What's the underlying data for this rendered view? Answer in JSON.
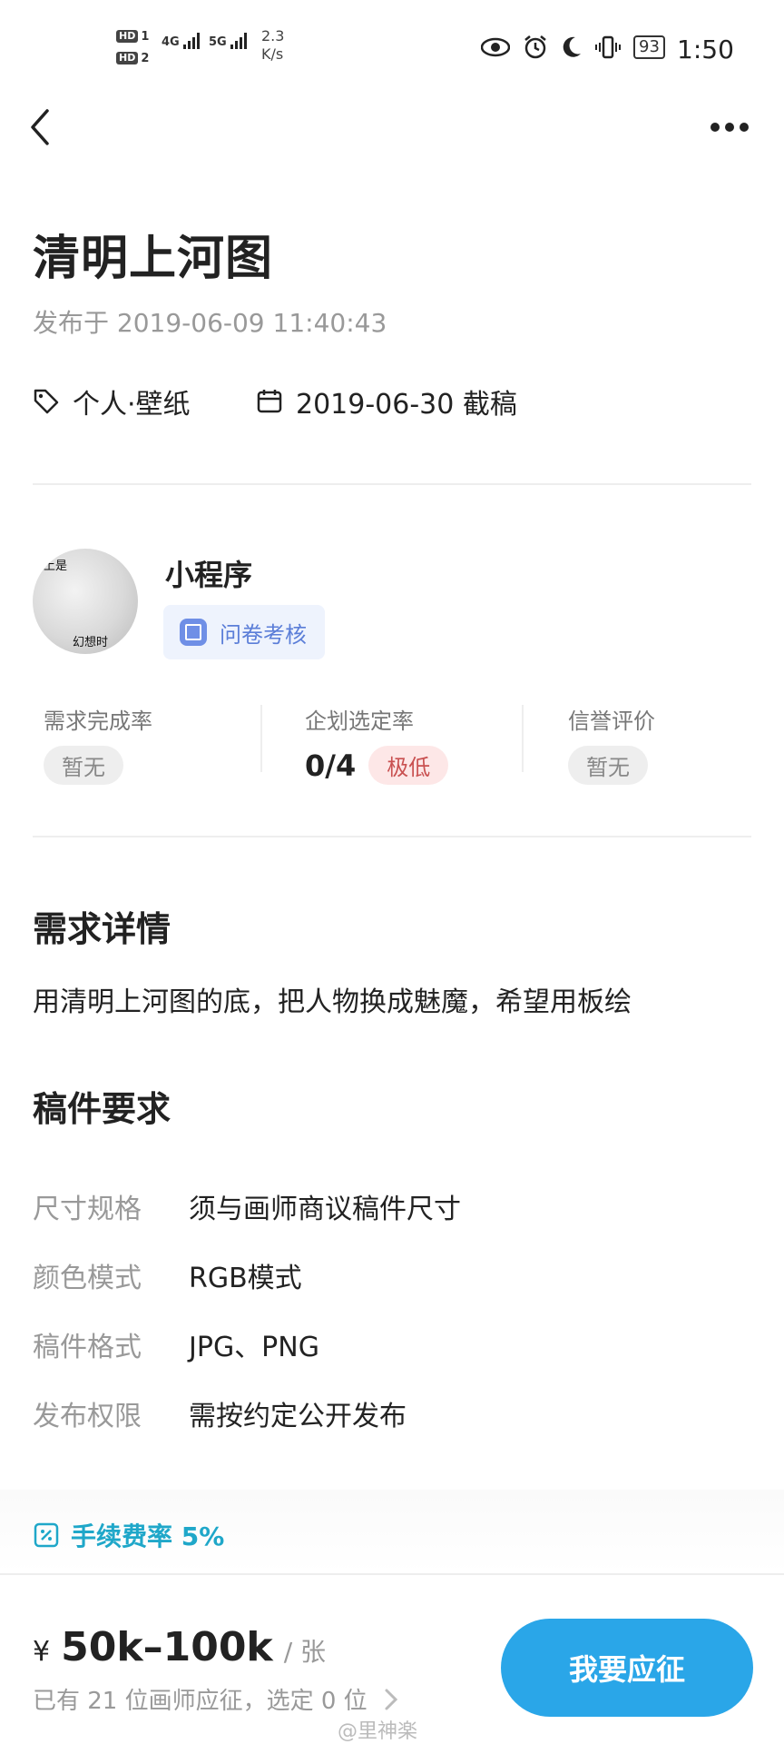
{
  "status_bar": {
    "hd1": "HD",
    "hd1_num": "1",
    "hd2": "HD",
    "hd2_num": "2",
    "net1": "4G",
    "net2": "5G",
    "speed_value": "2.3",
    "speed_unit": "K/s",
    "battery": "93",
    "time": "1:50"
  },
  "header": {
    "title": "清明上河图",
    "published": "发布于 2019-06-09 11:40:43",
    "category": "个人·壁纸",
    "deadline": "2019-06-30 截稿"
  },
  "avatar": {
    "text_top": "上是",
    "text_bottom": "幻想时"
  },
  "client": {
    "name": "小程序",
    "badge": "问卷考核"
  },
  "stats": [
    {
      "label": "需求完成率",
      "value": "暂无"
    },
    {
      "label": "企划选定率",
      "value": "0/4",
      "tag": "极低"
    },
    {
      "label": "信誉评价",
      "value": "暂无"
    }
  ],
  "details": {
    "title": "需求详情",
    "text": "用清明上河图的底，把人物换成魅魔，希望用板绘"
  },
  "requirements": {
    "title": "稿件要求",
    "rows": [
      {
        "label": "尺寸规格",
        "value": "须与画师商议稿件尺寸"
      },
      {
        "label": "颜色模式",
        "value": "RGB模式"
      },
      {
        "label": "稿件格式",
        "value": "JPG、PNG"
      },
      {
        "label": "发布权限",
        "value": "需按约定公开发布"
      }
    ]
  },
  "fee": {
    "label": "手续费率 5%"
  },
  "footer": {
    "currency": "¥",
    "price": "50k–100k",
    "unit": "/ 张",
    "applicants": "已有 21 位画师应征，选定 0 位",
    "cta": "我要应征",
    "watermark": "@里神楽"
  },
  "colors": {
    "accent": "#2aa6e8",
    "fee": "#1fa7c9",
    "badge_blue": "#5b7ed8",
    "tag_red": "#c95151"
  }
}
